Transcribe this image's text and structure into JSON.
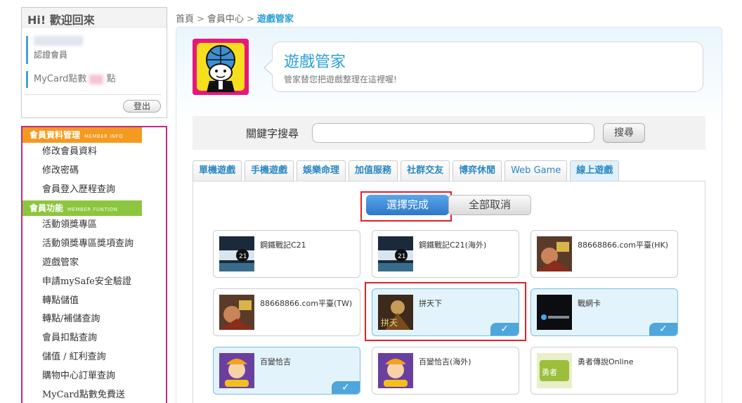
{
  "sidebar": {
    "welcome_title": "Hi! 歡迎回來",
    "member_level": "認證會員",
    "points_prefix": "MyCard點數",
    "points_suffix": "點",
    "logout_label": "登出",
    "member_info_header": "會員資料管理",
    "member_info_header_en": "MEMBER INFO",
    "member_info_items": [
      "修改會員資料",
      "修改密碼",
      "會員登入歷程查詢"
    ],
    "member_function_header": "會員功能",
    "member_function_header_en": "MEMBER FUNTION",
    "member_function_items": [
      "活動領獎專區",
      "活動領獎專區獎項查詢",
      "遊戲管家",
      "申請mySafe安全驗證",
      "轉點儲值",
      "轉點/補儲查詢",
      "會員扣點查詢",
      "儲值 / 紅利查詢",
      "購物中心訂單查詢",
      "MyCard點數免費送"
    ]
  },
  "breadcrumb": {
    "home": "首頁",
    "member_center": "會員中心",
    "current": "遊戲管家",
    "separator": ">"
  },
  "header": {
    "title": "遊戲管家",
    "subtitle": "管家替您把遊戲整理在這裡喔!"
  },
  "search": {
    "label": "關鍵字搜尋",
    "value": "",
    "button_label": "搜尋"
  },
  "tabs": [
    {
      "label": "單機遊戲",
      "active": false
    },
    {
      "label": "手機遊戲",
      "active": false
    },
    {
      "label": "娛樂命理",
      "active": false
    },
    {
      "label": "加值服務",
      "active": false
    },
    {
      "label": "社群交友",
      "active": false
    },
    {
      "label": "博弈休閒",
      "active": false
    },
    {
      "label": "Web Game",
      "active": false
    },
    {
      "label": "線上遊戲",
      "active": true
    }
  ],
  "actions": {
    "confirm_label": "選擇完成",
    "cancel_label": "全部取消"
  },
  "games": [
    {
      "name": "鋼鐵戰記C21",
      "selected": false
    },
    {
      "name": "鋼鐵戰記C21(海外)",
      "selected": false
    },
    {
      "name": "88668866.com平臺(HK)",
      "selected": false
    },
    {
      "name": "88668866.com平臺(TW)",
      "selected": false
    },
    {
      "name": "拼天下",
      "selected": true
    },
    {
      "name": "戰網卡",
      "selected": true
    },
    {
      "name": "百變恰吉",
      "selected": true
    },
    {
      "name": "百變恰吉(海外)",
      "selected": false
    },
    {
      "name": "勇者傳說Online",
      "selected": false
    }
  ],
  "check_mark": "✓",
  "colors": {
    "accent_blue": "#2a9fd6",
    "highlight_red": "#e0202a",
    "menu_border": "#c2288b",
    "orange_header": "#f39a1f",
    "green_header": "#8cc63f"
  }
}
